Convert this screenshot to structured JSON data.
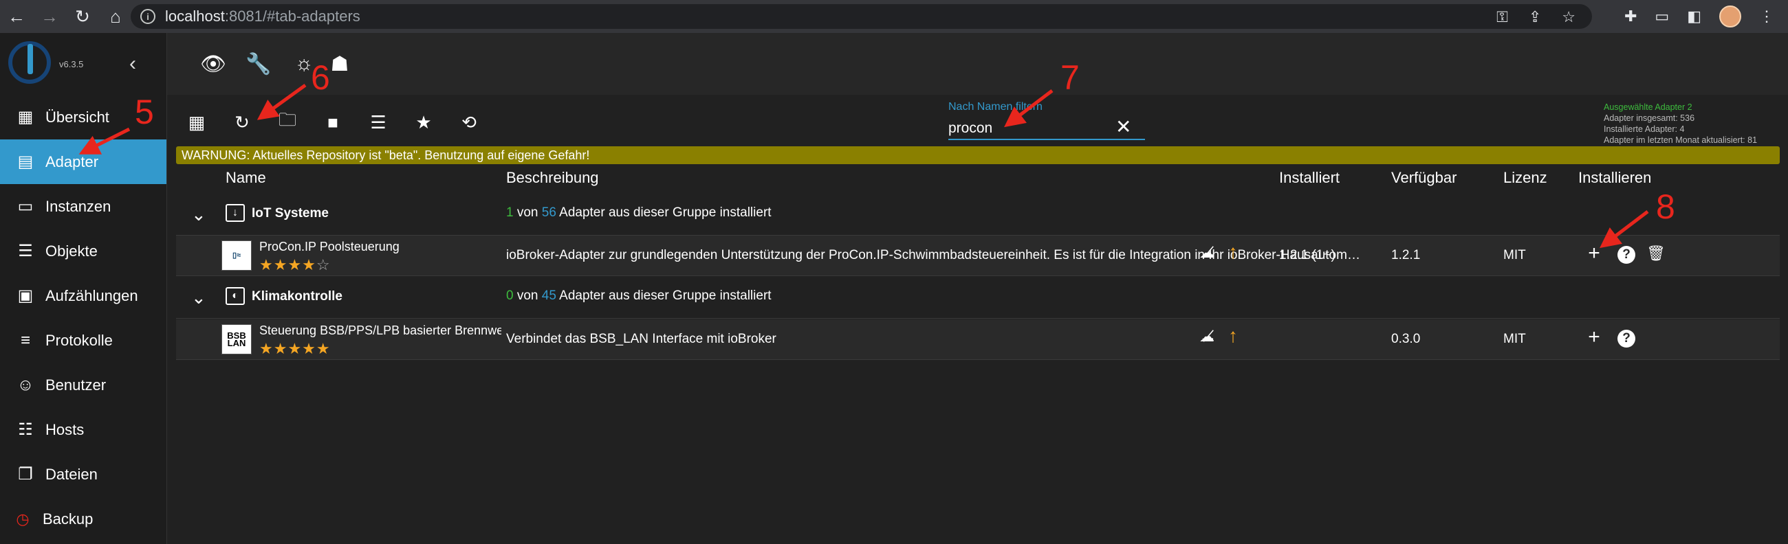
{
  "browser": {
    "url_host": "localhost",
    "url_rest": ":8081/#tab-adapters",
    "back_icon": "arrow-left-icon",
    "forward_icon": "arrow-right-icon",
    "reload_icon": "reload-icon",
    "home_icon": "home-icon"
  },
  "sidebar": {
    "version": "v6.3.5",
    "items": [
      {
        "label": "Übersicht",
        "icon": "grid-icon"
      },
      {
        "label": "Adapter",
        "icon": "store-icon"
      },
      {
        "label": "Instanzen",
        "icon": "instances-icon"
      },
      {
        "label": "Objekte",
        "icon": "list-icon"
      },
      {
        "label": "Aufzählungen",
        "icon": "enums-icon"
      },
      {
        "label": "Protokolle",
        "icon": "log-icon"
      },
      {
        "label": "Benutzer",
        "icon": "user-icon"
      },
      {
        "label": "Hosts",
        "icon": "hosts-icon"
      },
      {
        "label": "Dateien",
        "icon": "files-icon"
      },
      {
        "label": "Backup",
        "icon": "backup-icon"
      }
    ]
  },
  "toolbar": {
    "filter_label": "Nach Namen filtern",
    "filter_value": "procon"
  },
  "stats": {
    "selected": "Ausgewählte Adapter 2",
    "total": "Adapter insgesamt: 536",
    "installed": "Installierte Adapter: 4",
    "updated": "Adapter im letzten Monat aktualisiert: 81"
  },
  "warning": "WARNUNG: Aktuelles Repository ist \"beta\". Benutzung auf eigene Gefahr!",
  "table": {
    "headers": {
      "name": "Name",
      "description": "Beschreibung",
      "installed": "Installiert",
      "available": "Verfügbar",
      "license": "Lizenz",
      "install": "Installieren"
    },
    "groups": [
      {
        "name": "IoT Systeme",
        "installed": "1",
        "von": "von",
        "total": "56",
        "suffix": "Adapter aus dieser Gruppe installiert",
        "adapter": {
          "title": "ProCon.IP Poolsteuerung",
          "rating": 4,
          "description": "ioBroker-Adapter zur grundlegenden Unterstützung der ProCon.IP-Schwimmbadsteuereinheit. Es ist für die Integration in Ihr ioBroker-Hausautomationssystem gedacht.",
          "installed": "1.2.1 (1~)",
          "available": "1.2.1",
          "license": "MIT"
        }
      },
      {
        "name": "Klimakontrolle",
        "installed": "0",
        "von": "von",
        "total": "45",
        "suffix": "Adapter aus dieser Gruppe installiert",
        "adapter": {
          "title": "Steuerung BSB/PPS/LPB basierter Brennwertthermen",
          "icon_text": "BSB LAN",
          "rating": 5,
          "description": "Verbindet das BSB_LAN Interface mit ioBroker",
          "installed": "",
          "available": "0.3.0",
          "license": "MIT"
        }
      }
    ]
  },
  "annotations": [
    "5",
    "6",
    "7",
    "8"
  ],
  "colors": {
    "accent": "#3399cc",
    "warning_bg": "#8a8000",
    "star": "#f5a623",
    "annotation": "#e8261d",
    "installed_count": "#3dbb3d"
  }
}
